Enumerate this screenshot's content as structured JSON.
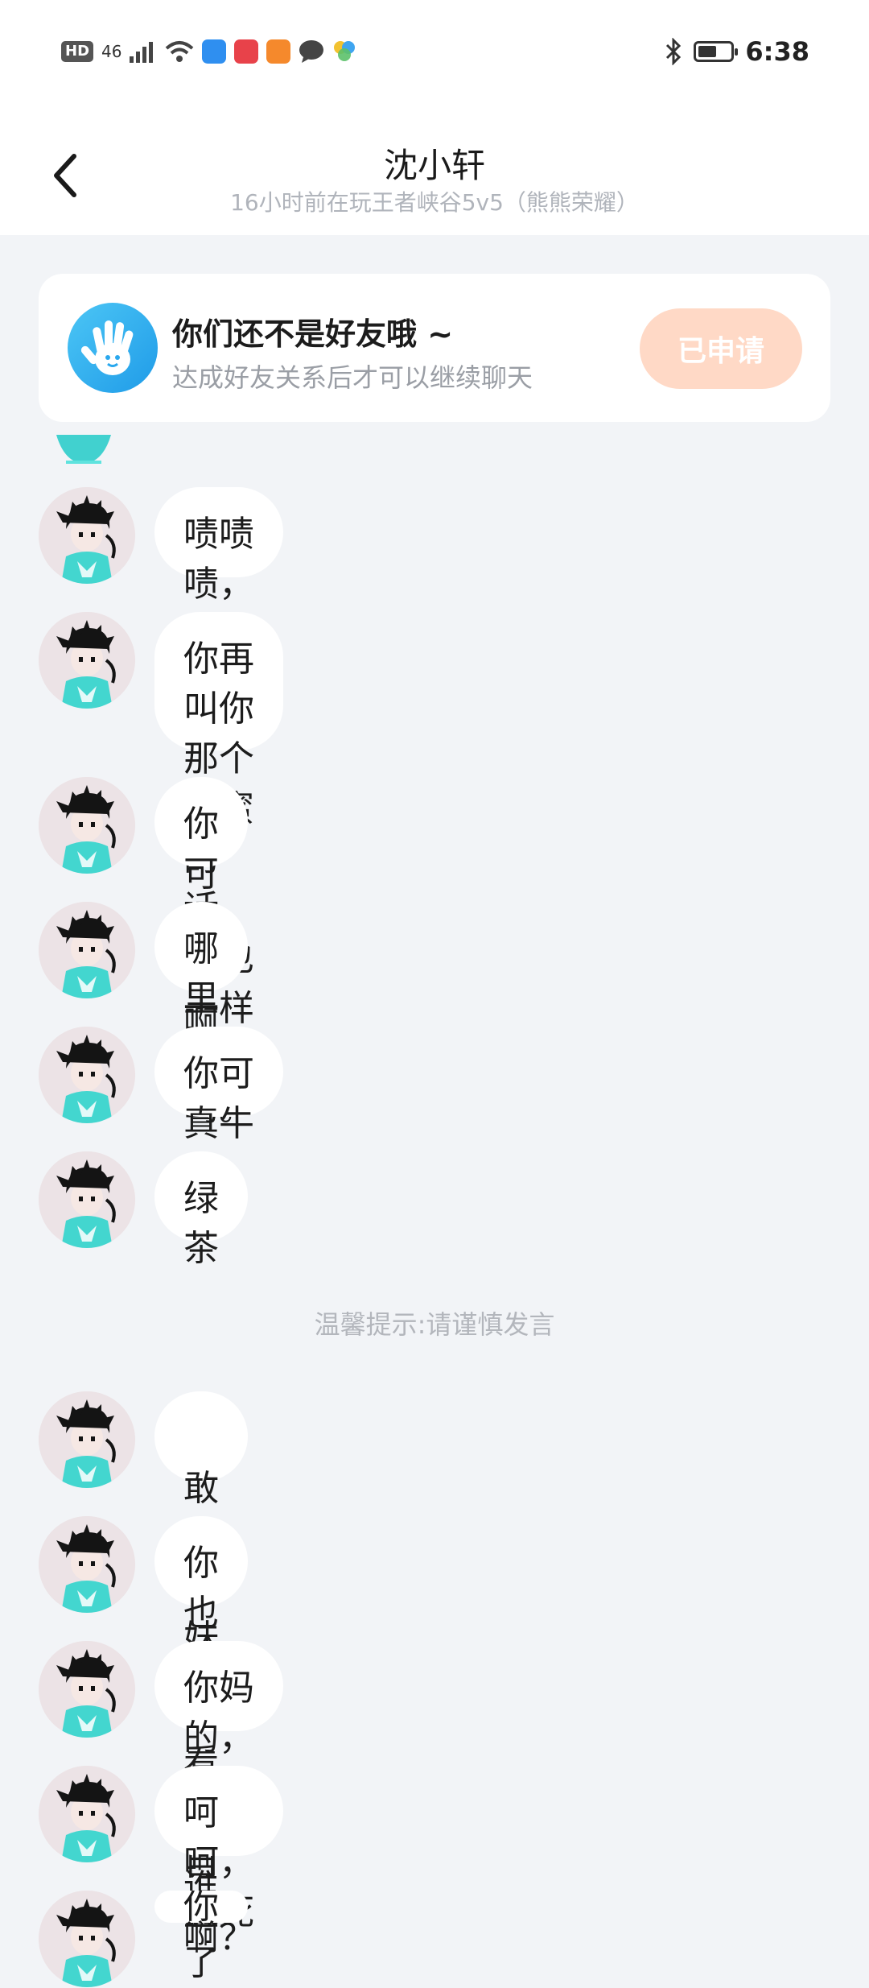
{
  "status_bar": {
    "hd": "HD",
    "network": "46",
    "time": "6:38",
    "battery_level": 0.55,
    "icons": [
      "signal-icon",
      "wifi-icon",
      "cloud-app-icon",
      "book-app-icon",
      "video-app-icon",
      "message-icon",
      "pinwheel-app-icon",
      "bluetooth-icon",
      "battery-icon"
    ]
  },
  "header": {
    "title": "沈小轩",
    "subtitle": "16小时前在玩王者峡谷5v5（熊熊荣耀）"
  },
  "notice": {
    "title": "你们还不是好友哦 ~",
    "description": "达成好友关系后才可以继续聊天",
    "button_label": "已申请",
    "colors": {
      "icon_bg": "#2aa8ee",
      "button_bg": "#ffd9c6"
    }
  },
  "messages": [
    {
      "text": "啧啧啧，看你就烦。"
    },
    {
      "text": "你再叫你那个闺蜜的话，我也\n一样会骂。"
    },
    {
      "text": "你可真牛啊"
    },
    {
      "text": "哪里来的"
    },
    {
      "text": "你可真牛啊。"
    },
    {
      "text": "绿茶"
    },
    {
      "text": " 敢骂我妹"
    },
    {
      "text": "你也不看看你自己"
    },
    {
      "text": "你妈的，你以为你谁啊？"
    },
    {
      "text": "呵呵，丑死了"
    },
    {
      "text": "你说你的更吃不是"
    }
  ],
  "tip": "温馨提示:请谨慎发言"
}
